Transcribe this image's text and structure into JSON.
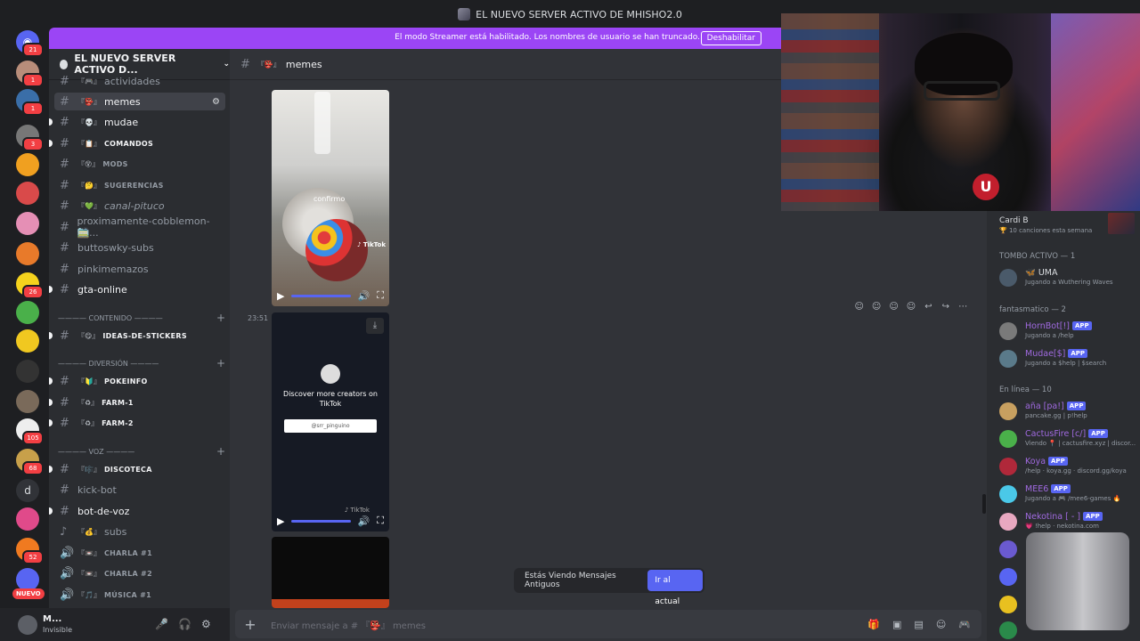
{
  "window": {
    "title": "EL NUEVO SERVER ACTIVO DE MHISHO2.0"
  },
  "banner": {
    "text": "El modo Streamer está habilitado. Los nombres de usuario se han truncado.",
    "button": "Deshabilitar"
  },
  "server": {
    "name": "EL NUEVO SERVER ACTIVO D..."
  },
  "rail": {
    "badges": [
      "21",
      "1",
      "1",
      "3",
      "26",
      "105",
      "68",
      "52"
    ],
    "dm_letter": "d",
    "nuevo": "NUEVO"
  },
  "channels": [
    {
      "emoji": "『🎮』",
      "name": "actividades"
    },
    {
      "emoji": "『👺』",
      "name": "memes"
    },
    {
      "emoji": "『💀』",
      "name": "mudae"
    },
    {
      "emoji": "『📋』",
      "name": "COMANDOS"
    },
    {
      "emoji": "『😵』",
      "name": "MODS"
    },
    {
      "emoji": "『🤔』",
      "name": "SUGERENCIAS"
    },
    {
      "emoji": "『💚』",
      "name": "canal-pituco"
    },
    {
      "emoji": "",
      "name": "proximamente-cobblemon-🚞..."
    },
    {
      "emoji": "",
      "name": "buttoswky-subs"
    },
    {
      "emoji": "",
      "name": "pinkimemazos"
    },
    {
      "emoji": "",
      "name": "gta-online"
    },
    {
      "emoji": "『😋』",
      "name": "IDEAS-DE-STICKERS"
    },
    {
      "emoji": "『🔰』",
      "name": "POKEINFO"
    },
    {
      "emoji": "『♻』",
      "name": "FARM-1"
    },
    {
      "emoji": "『♻』",
      "name": "FARM-2"
    },
    {
      "emoji": "『🎼』",
      "name": "DISCOTECA"
    },
    {
      "emoji": "",
      "name": "kick-bot"
    },
    {
      "emoji": "",
      "name": "bot-de-voz"
    },
    {
      "emoji": "『💰』",
      "name": "subs"
    },
    {
      "emoji": "『📼』",
      "name": "CHARLA #1"
    },
    {
      "emoji": "『📼』",
      "name": "CHARLA #2"
    },
    {
      "emoji": "『🎵』",
      "name": "MÚSICA #1"
    }
  ],
  "categories": [
    "———— CONTENIDO ————",
    "———— DIVERSIÓN ————",
    "———— VOZ ————"
  ],
  "user": {
    "name": "M...",
    "status": "Invisible"
  },
  "chat": {
    "channel_emoji": "『👺』",
    "channel": "memes",
    "timestamp": "23:51",
    "video1_caption": "confirmo",
    "video1_tiktok": "♪ TikTok",
    "video2_text": "Discover more creators on TikTok",
    "video2_handle": "@srr_pinguino",
    "video2_tiktok": "♪ TikTok",
    "old_messages": "Estás Viendo Mensajes Antiguos",
    "jump": "Ir al actual",
    "composer_placeholder": "Enviar mensaje a # 『👺』 memes"
  },
  "members": {
    "activity_title": "Cardi B",
    "activity_sub": "🏆 10 canciones esta semana",
    "sections": [
      "TOMBO ACTIVO — 1",
      "fantasmatico — 2",
      "En línea — 10"
    ],
    "tombo": [
      {
        "name": "🦋 UMA",
        "activity": "Jugando a Wuthering Waves",
        "color": "#dbdee1"
      }
    ],
    "fantasmatico": [
      {
        "name": "HornBot[!]",
        "activity": "Jugando a /help",
        "color": "#a06ae0",
        "app": "APP"
      },
      {
        "name": "Mudae[$]",
        "activity": "Jugando a $help | $search",
        "color": "#a06ae0",
        "app": "APP"
      }
    ],
    "online": [
      {
        "name": "aña [pa!]",
        "activity": "pancake.gg | p!help",
        "color": "#a06ae0",
        "app": "APP"
      },
      {
        "name": "CactusFire [c/]",
        "activity": "Viendo 📍 | cactusfire.xyz | discor...",
        "color": "#a06ae0",
        "app": "APP"
      },
      {
        "name": "Koya",
        "activity": "/help · koya.gg · discord.gg/koya",
        "color": "#a06ae0",
        "app": "APP"
      },
      {
        "name": "MEE6",
        "activity": "Jugando a 🎮 /mee6-games 🔥",
        "color": "#a06ae0",
        "app": "APP"
      },
      {
        "name": "Nekotina [ - ]",
        "activity": "💗 !help · nekotina.com",
        "color": "#a06ae0",
        "app": "APP"
      }
    ]
  },
  "app_label": "APP",
  "composer_icons": [
    "gift-icon",
    "gif-icon",
    "sticker-icon",
    "emoji-icon",
    "activity-icon"
  ]
}
